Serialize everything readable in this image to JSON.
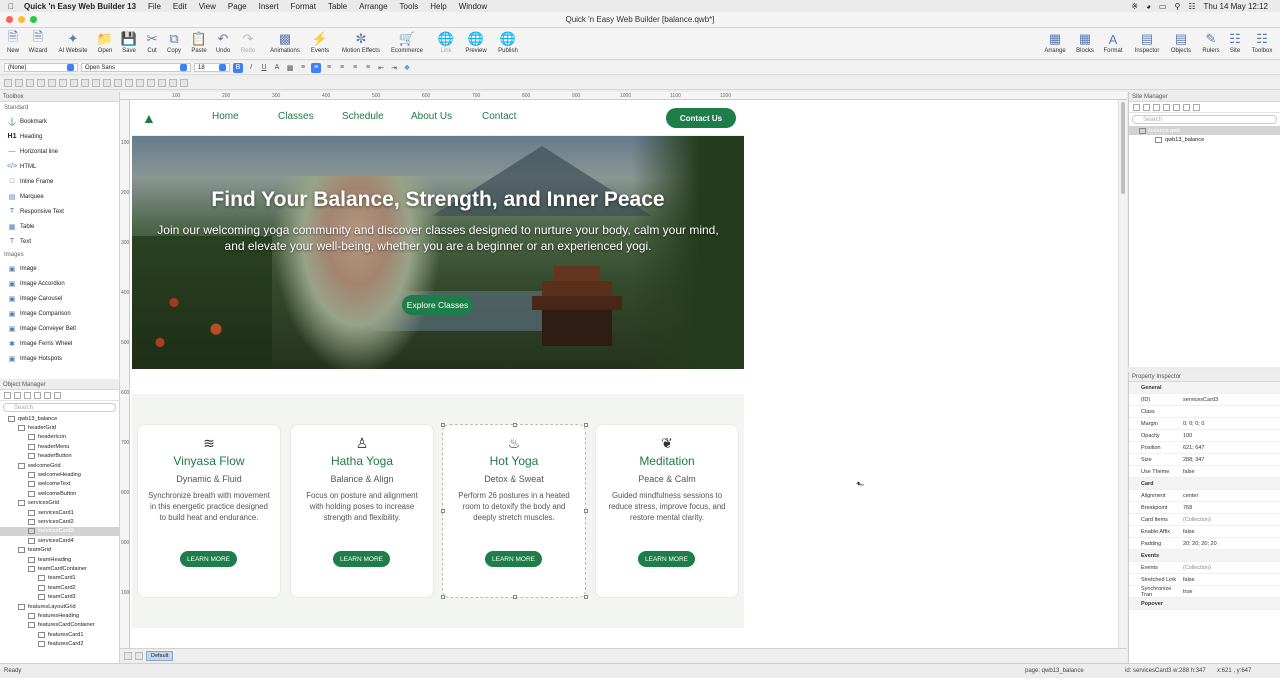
{
  "menubar": {
    "app": "Quick 'n Easy Web Builder 13",
    "items": [
      "File",
      "Edit",
      "View",
      "Page",
      "Insert",
      "Format",
      "Table",
      "Arrange",
      "Tools",
      "Help",
      "Window"
    ],
    "clock": "Thu 14 May 12:12"
  },
  "window": {
    "title": "Quick 'n Easy Web Builder [balance.qwb*]"
  },
  "toolbar": {
    "left": [
      "New",
      "Wizard",
      "AI Website",
      "Open",
      "Save",
      "Cut",
      "Copy",
      "Paste",
      "Undo",
      "Redo",
      "Animations",
      "Events",
      "Motion Effects",
      "Ecommerce",
      "Link",
      "Preview",
      "Publish"
    ],
    "right": [
      "Arrange",
      "Blocks",
      "Format",
      "Inspector",
      "Objects",
      "Rulers",
      "Site",
      "Toolbox"
    ]
  },
  "format": {
    "style": "(None)",
    "font": "Open Sans",
    "size": "18"
  },
  "toolbox": {
    "title": "Toolbox",
    "section_standard": "Standard",
    "standard": [
      "Bookmark",
      "Heading",
      "Horizontal line",
      "HTML",
      "Inline Frame",
      "Marquee",
      "Responsive Text",
      "Table",
      "Text"
    ],
    "section_images": "Images",
    "images": [
      "Image",
      "Image Accordion",
      "Image Carousel",
      "Image Comparison",
      "Image Conveyer Belt",
      "Image Ferris Wheel",
      "Image Hotspots"
    ]
  },
  "objmgr": {
    "title": "Object Manager",
    "search_placeholder": "Search",
    "rows": [
      "qwb13_balance",
      "headerGrid",
      "headerIcon",
      "headerMenu",
      "headerButton",
      "welcomeGrid",
      "welcomeHeading",
      "welcomeText",
      "welcomeButton",
      "servicesGrid",
      "servicesCard1",
      "servicesCard2",
      "servicesCard3",
      "servicesCard4",
      "teamGrid",
      "teamHeading",
      "teamCardContainer",
      "teamCard1",
      "teamCard2",
      "teamCard3",
      "featuresLayoutGrid",
      "featuresHeading",
      "featuresCardContainer",
      "featuresCard1",
      "featuresCard2"
    ]
  },
  "ruler": {
    "h": [
      "100",
      "200",
      "300",
      "400",
      "500",
      "600",
      "700",
      "800",
      "900",
      "1000",
      "1100",
      "1200"
    ],
    "v": [
      "100",
      "200",
      "300",
      "400",
      "500",
      "600",
      "700",
      "800",
      "900",
      "1000"
    ]
  },
  "site": {
    "nav": [
      "Home",
      "Classes",
      "Schedule",
      "About Us",
      "Contact"
    ],
    "contact_btn": "Contact Us",
    "hero_title": "Find Your Balance, Strength, and Inner Peace",
    "hero_text": "Join our welcoming yoga community and discover classes designed to nurture your body, calm your mind, and elevate your well-being, whether you are a beginner or an experienced yogi.",
    "hero_btn": "Explore Classes",
    "cards": [
      {
        "icon": "wind-icon",
        "title": "Vinyasa Flow",
        "subtitle": "Dynamic & Fluid",
        "desc": "Synchronize breath with movement in this energetic practice designed to build heat and endurance.",
        "btn": "LEARN MORE"
      },
      {
        "icon": "person-icon",
        "title": "Hatha Yoga",
        "subtitle": "Balance & Align",
        "desc": "Focus on posture and alignment with holding poses to increase strength and flexibility.",
        "btn": "LEARN MORE"
      },
      {
        "icon": "fire-icon",
        "title": "Hot Yoga",
        "subtitle": "Detox & Sweat",
        "desc": "Perform 26 postures in a heated room to detoxify the body and deeply stretch muscles.",
        "btn": "LEARN MORE"
      },
      {
        "icon": "leaf-icon",
        "title": "Meditation",
        "subtitle": "Peace & Calm",
        "desc": "Guided mindfulness sessions to reduce stress, improve focus, and restore mental clarity.",
        "btn": "LEARN MORE"
      }
    ]
  },
  "sitemgr": {
    "title": "Site Manager",
    "search_placeholder": "Search",
    "root": "balance.qwb",
    "page": "qwb13_balance"
  },
  "inspector": {
    "title": "Property Inspector",
    "rows": [
      [
        "General",
        ""
      ],
      [
        "(ID)",
        "servicesCard3"
      ],
      [
        "Class",
        ""
      ],
      [
        "Margin",
        "0; 0; 0; 0"
      ],
      [
        "Opacity",
        "100"
      ],
      [
        "Position",
        "621; 647"
      ],
      [
        "Size",
        "288; 347"
      ],
      [
        "Use Theme",
        "false"
      ],
      [
        "Card",
        ""
      ],
      [
        "Alignment",
        "center"
      ],
      [
        "Breakpoint",
        "768"
      ],
      [
        "Card Items",
        "(Collection)"
      ],
      [
        "Enable Affix",
        "false"
      ],
      [
        "Padding",
        "20; 20; 20; 20"
      ],
      [
        "Events",
        ""
      ],
      [
        "Events",
        "(Collection)"
      ],
      [
        "Stretched Link",
        "false"
      ],
      [
        "Synchronize Tran",
        "true"
      ],
      [
        "Popover",
        ""
      ]
    ]
  },
  "pagetabs": {
    "tab": "Default"
  },
  "status": {
    "left": "Ready",
    "page": "page: qwb13_balance",
    "id": "id: servicesCard3 w:288 h:347",
    "xy": "x:621 , y:647"
  },
  "colors": {
    "brand": "#1e7e4a",
    "accent": "#3b82f6"
  }
}
